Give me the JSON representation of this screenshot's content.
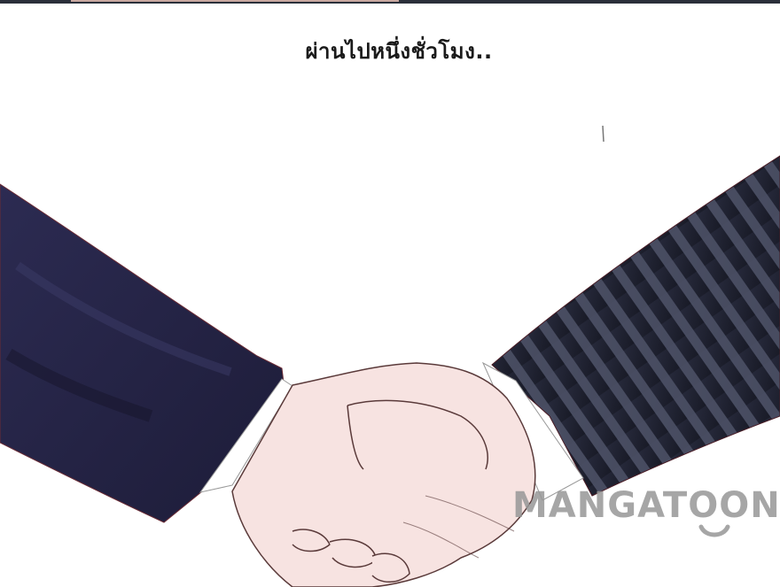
{
  "panel": {
    "caption": "ผ่านไปหนึ่งชั่วโมง.."
  },
  "watermark": {
    "text": "MANGATOON"
  },
  "colors": {
    "left_sleeve": "#2b2a4e",
    "right_sleeve": "#1f2233",
    "skin": "#f7e3e1",
    "cuff": "#ffffff"
  }
}
